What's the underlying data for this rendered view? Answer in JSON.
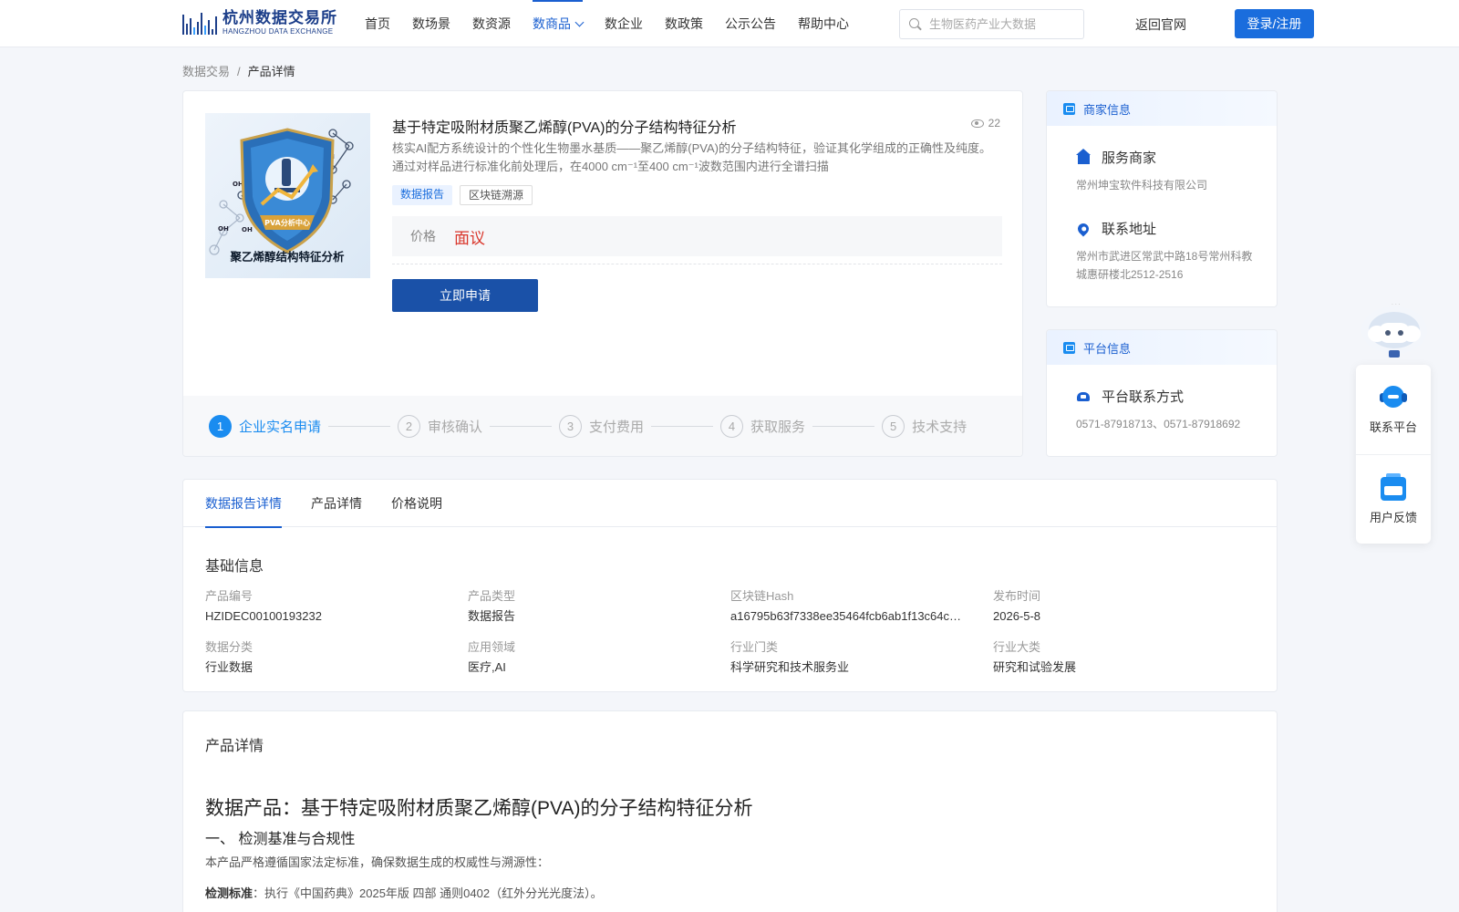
{
  "header": {
    "logo_cn": "杭州数据交易所",
    "logo_en": "HANGZHOU DATA EXCHANGE",
    "nav": [
      {
        "label": "首页"
      },
      {
        "label": "数场景"
      },
      {
        "label": "数资源"
      },
      {
        "label": "数商品",
        "active": true
      },
      {
        "label": "数企业"
      },
      {
        "label": "数政策"
      },
      {
        "label": "公示公告"
      },
      {
        "label": "帮助中心"
      }
    ],
    "search_placeholder": "生物医药产业大数据",
    "back_link": "返回官网",
    "login_label": "登录/注册",
    "accent_color": "#1a6ddd"
  },
  "breadcrumb": {
    "root": "数据交易",
    "separator": "/",
    "current": "产品详情"
  },
  "product": {
    "image_caption": "聚乙烯醇结构特征分析",
    "image_badge": "PVA分析中心",
    "title": "基于特定吸附材质聚乙烯醇(PVA)的分子结构特征分析",
    "views": "22",
    "description": "核实AI配方系统设计的个性化生物墨水基质——聚乙烯醇(PVA)的分子结构特征，验证其化学组成的正确性及纯度。通过对样品进行标准化前处理后，在4000 cm⁻¹至400 cm⁻¹波数范围内进行全谱扫描",
    "tags": [
      "数据报告",
      "区块链溯源"
    ],
    "price_label": "价格",
    "price_value": "面议",
    "apply_label": "立即申请",
    "price_color": "#d9362b"
  },
  "steps": [
    {
      "num": "1",
      "label": "企业实名申请",
      "active": true
    },
    {
      "num": "2",
      "label": "审核确认"
    },
    {
      "num": "3",
      "label": "支付费用"
    },
    {
      "num": "4",
      "label": "获取服务"
    },
    {
      "num": "5",
      "label": "技术支持"
    }
  ],
  "merchant": {
    "header": "商家信息",
    "service_title": "服务商家",
    "service_value": "常州坤宝软件科技有限公司",
    "address_title": "联系地址",
    "address_value": "常州市武进区常武中路18号常州科教城惠研楼北2512-2516"
  },
  "platform": {
    "header": "平台信息",
    "contact_title": "平台联系方式",
    "contact_value": "0571-87918713、0571-87918692"
  },
  "tabs": [
    {
      "label": "数据报告详情",
      "active": true
    },
    {
      "label": "产品详情"
    },
    {
      "label": "价格说明"
    }
  ],
  "basic_info": {
    "title": "基础信息",
    "fields": [
      {
        "key": "产品编号",
        "value": "HZIDEC00100193232"
      },
      {
        "key": "产品类型",
        "value": "数据报告"
      },
      {
        "key": "区块链Hash",
        "value": "a16795b63f7338ee35464fcb6ab1f13c64c…"
      },
      {
        "key": "发布时间",
        "value": "2026-5-8"
      },
      {
        "key": "数据分类",
        "value": "行业数据"
      },
      {
        "key": "应用领域",
        "value": "医疗,AI"
      },
      {
        "key": "行业门类",
        "value": "科学研究和技术服务业"
      },
      {
        "key": "行业大类",
        "value": "研究和试验发展"
      }
    ]
  },
  "detail": {
    "title": "产品详情",
    "heading": "数据产品：基于特定吸附材质聚乙烯醇(PVA)的分子结构特征分析",
    "subheading": "一、 检测基准与合规性",
    "paragraph": "本产品严格遵循国家法定标准，确保数据生成的权威性与溯源性：",
    "item_label": "检测标准",
    "item_text": "：执行《中国药典》2025年版 四部 通则0402（红外分光光度法）。"
  },
  "float": {
    "contact": "联系平台",
    "feedback": "用户反馈"
  }
}
